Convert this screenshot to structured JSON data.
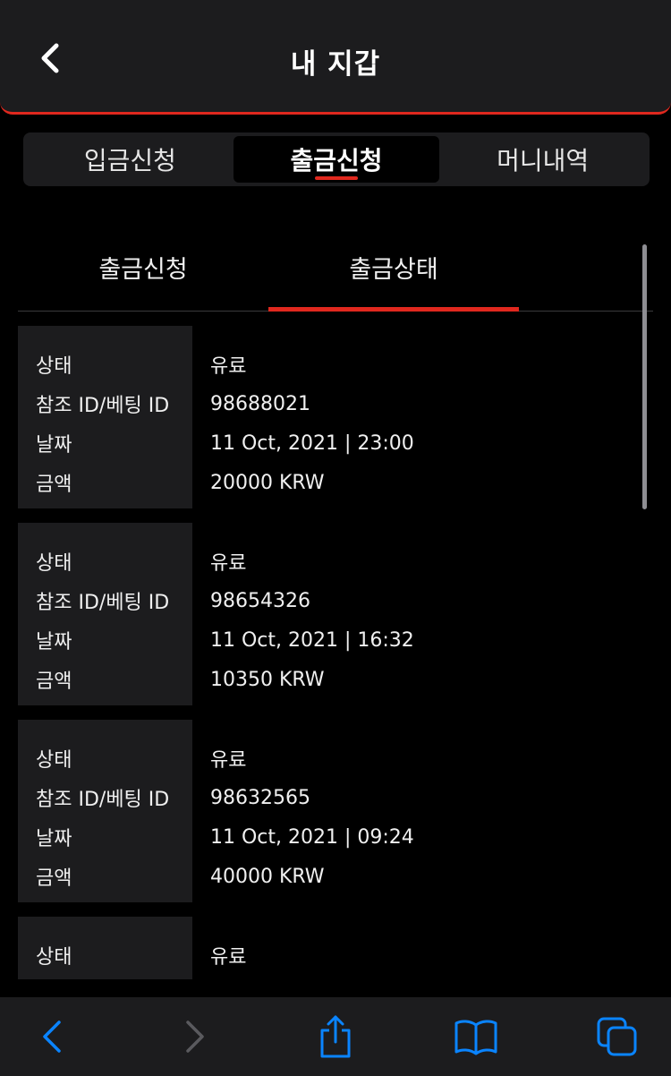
{
  "header": {
    "title": "내 지갑",
    "back_icon": "chevron-left-icon"
  },
  "tabs": [
    {
      "label": "입금신청",
      "active": false
    },
    {
      "label": "출금신청",
      "active": true
    },
    {
      "label": "머니내역",
      "active": false
    }
  ],
  "subtabs": [
    {
      "label": "출금신청",
      "active": false
    },
    {
      "label": "출금상태",
      "active": true
    }
  ],
  "field_labels": {
    "status": "상태",
    "ref_id": "참조 ID/베팅 ID",
    "date": "날짜",
    "amount": "금액"
  },
  "records": [
    {
      "status": "유료",
      "ref_id": "98688021",
      "date": "11 Oct, 2021 | 23:00",
      "amount": "20000 KRW"
    },
    {
      "status": "유료",
      "ref_id": "98654326",
      "date": "11 Oct, 2021 | 16:32",
      "amount": "10350 KRW"
    },
    {
      "status": "유료",
      "ref_id": "98632565",
      "date": "11 Oct, 2021 | 09:24",
      "amount": "40000 KRW"
    },
    {
      "status": "유료"
    }
  ],
  "browser_toolbar": {
    "icons": [
      "back-arrow-icon",
      "forward-arrow-icon",
      "share-icon",
      "bookmarks-icon",
      "tabs-icon"
    ],
    "accent_color": "#0a84ff",
    "disabled_color": "#5a5a5e"
  },
  "colors": {
    "accent": "#e0281e",
    "panel": "#1c1c1e",
    "background": "#000000"
  }
}
